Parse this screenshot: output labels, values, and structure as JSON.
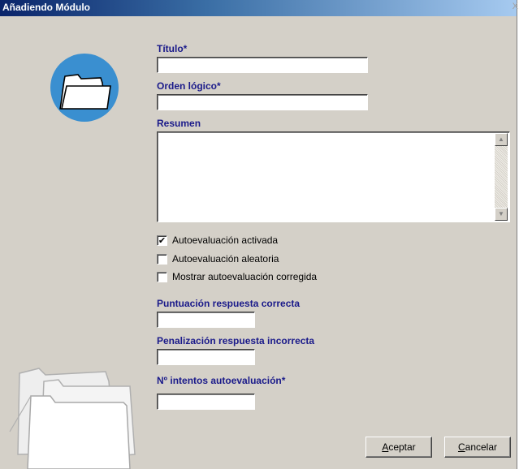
{
  "window": {
    "title": "Añadiendo Módulo",
    "close_glyph": "X"
  },
  "form": {
    "titulo": {
      "label": "Título*",
      "value": ""
    },
    "orden": {
      "label": "Orden lógico*",
      "value": ""
    },
    "resumen": {
      "label": "Resumen",
      "value": ""
    },
    "checks": [
      {
        "label": "Autoevaluación activada",
        "checked": true,
        "mark": "✔"
      },
      {
        "label": "Autoevaluación aleatoria",
        "checked": false,
        "mark": ""
      },
      {
        "label": "Mostrar autoevaluación corregida",
        "checked": false,
        "mark": ""
      }
    ],
    "puntuacion": {
      "label": "Puntuación respuesta correcta",
      "value": ""
    },
    "penalizacion": {
      "label": "Penalización respuesta incorrecta",
      "value": ""
    },
    "intentos": {
      "label": "Nº intentos autoevaluación*",
      "value": ""
    }
  },
  "buttons": {
    "accept": {
      "accel": "A",
      "rest": "ceptar"
    },
    "cancel": {
      "accel": "C",
      "rest": "ancelar"
    }
  },
  "icons": {
    "header": "folder-circle-icon",
    "decoration": "stacked-folders-icon",
    "scroll_up": "scroll-up-arrow",
    "scroll_down": "scroll-down-arrow"
  },
  "colors": {
    "titlebar": "#0a246a",
    "label": "#1a1a8a",
    "face": "#d4d0c8",
    "circle": "#3a8fd0"
  }
}
